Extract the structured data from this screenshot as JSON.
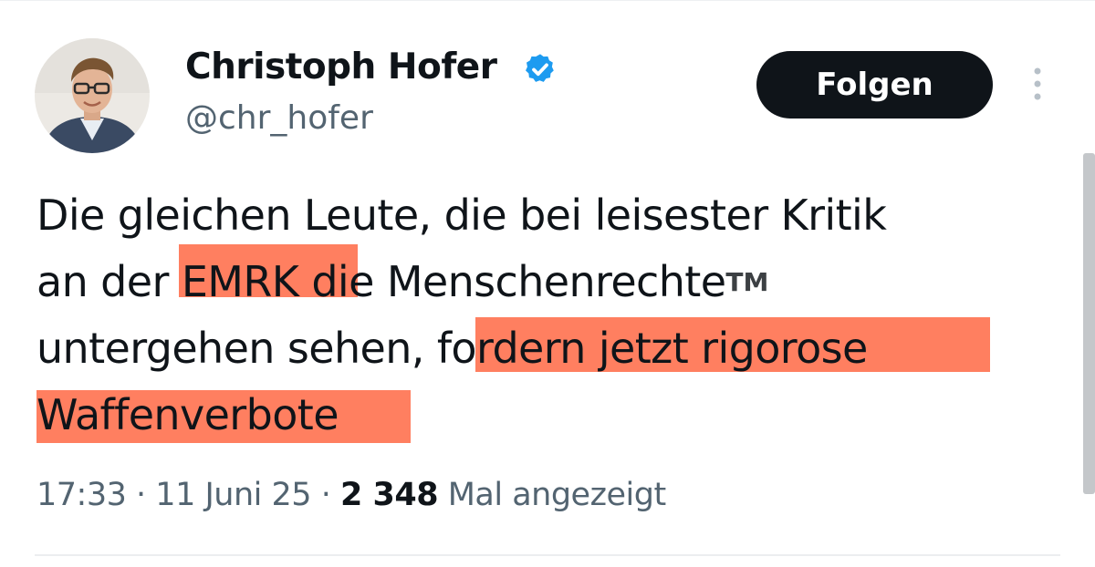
{
  "author": {
    "display_name": "Christoph Hofer",
    "handle": "@chr_hofer",
    "verified": true,
    "verified_color": "#1d9bf0"
  },
  "actions": {
    "follow_label": "Folgen",
    "more_icon": "more-vertical-icon"
  },
  "tweet": {
    "lines": [
      "Die gleichen Leute, die bei leisester Kritik",
      "an der EMRK die Menschenrechte",
      "untergehen sehen, fordern jetzt rigorose",
      "Waffenverbote"
    ],
    "line2_prefix": "an der ",
    "line2_emrk": "EMRK",
    "line2_suffix": " die Menschenrechte",
    "trademark": "TM",
    "line3_prefix": "untergehen sehen, ",
    "line3_highlighted": "fordern jetzt rigorose",
    "line4": "Waffenverbote",
    "highlight_color": "#ff7f60"
  },
  "meta": {
    "time": "17:33",
    "separator": "·",
    "date": "11 Juni 25",
    "views_count": "2 348",
    "views_label": "Mal angezeigt"
  }
}
